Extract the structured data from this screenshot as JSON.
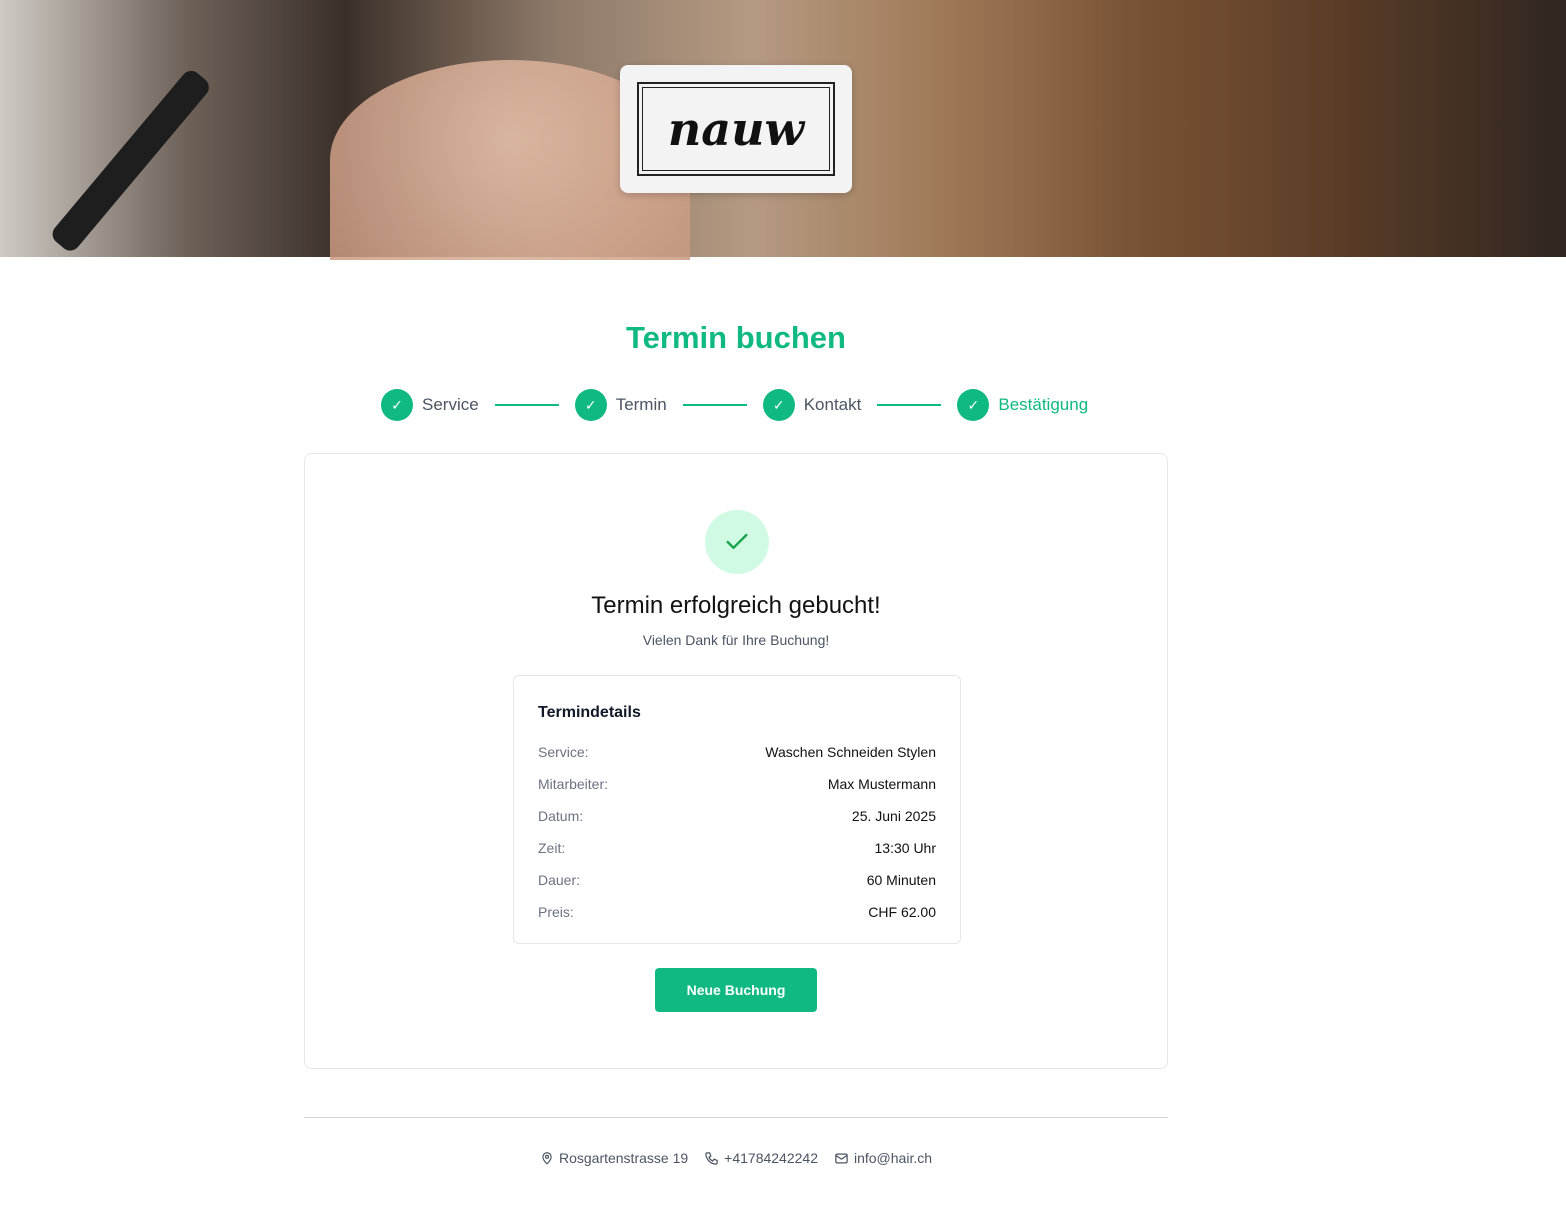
{
  "logo": {
    "text": "nauw"
  },
  "title": "Termin buchen",
  "steps": [
    {
      "label": "Service"
    },
    {
      "label": "Termin"
    },
    {
      "label": "Kontakt"
    },
    {
      "label": "Bestätigung"
    }
  ],
  "confirmation": {
    "title": "Termin erfolgreich gebucht!",
    "subtitle": "Vielen Dank für Ihre Buchung!"
  },
  "details": {
    "title": "Termindetails",
    "rows": [
      {
        "k": "Service:",
        "v": "Waschen Schneiden Stylen"
      },
      {
        "k": "Mitarbeiter:",
        "v": "Max Mustermann"
      },
      {
        "k": "Datum:",
        "v": "25. Juni 2025"
      },
      {
        "k": "Zeit:",
        "v": "13:30 Uhr"
      },
      {
        "k": "Dauer:",
        "v": "60 Minuten"
      },
      {
        "k": "Preis:",
        "v": "CHF 62.00"
      }
    ]
  },
  "button": "Neue Buchung",
  "footer": {
    "address": "Rosgartenstrasse 19",
    "phone": "+41784242242",
    "email": "info@hair.ch"
  },
  "colors": {
    "accent": "#10b981"
  }
}
